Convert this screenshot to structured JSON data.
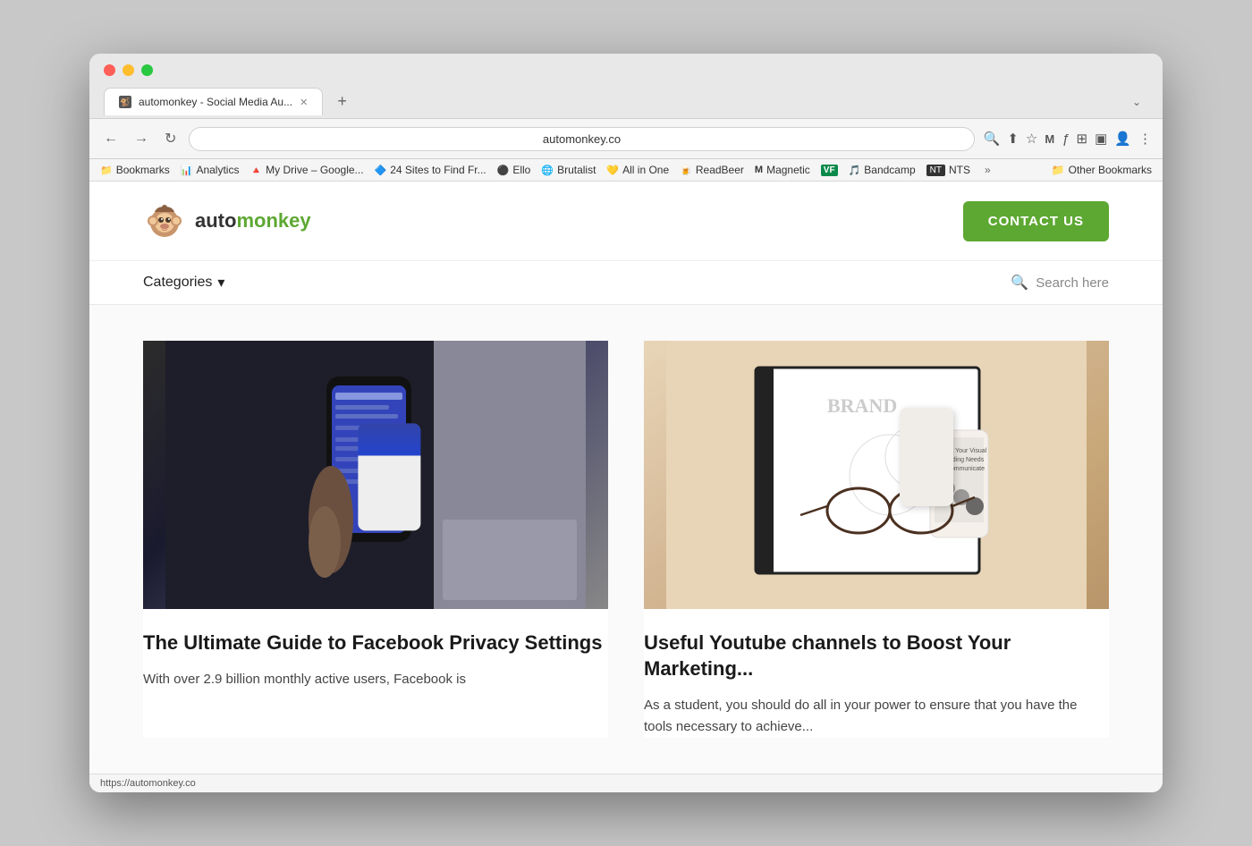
{
  "browser": {
    "tab_title": "automonkey - Social Media Au...",
    "tab_favicon": "🐒",
    "new_tab_icon": "+",
    "address": "automonkey.co",
    "expand_icon": "⌄",
    "nav": {
      "back": "←",
      "forward": "→",
      "reload": "↻"
    },
    "toolbar": {
      "search_icon": "🔍",
      "share_icon": "⬆",
      "bookmark_icon": "☆",
      "mail_icon": "M",
      "script_icon": "ƒ",
      "puzzle_icon": "⊞",
      "sidebar_icon": "▣",
      "avatar_icon": "👤",
      "more_icon": "⋮"
    },
    "bookmarks": [
      {
        "icon": "📁",
        "label": "Bookmarks"
      },
      {
        "icon": "📊",
        "label": "Analytics"
      },
      {
        "icon": "🔺",
        "label": "My Drive – Google..."
      },
      {
        "icon": "🔷",
        "label": "24 Sites to Find Fr..."
      },
      {
        "icon": "⚫",
        "label": "Ello"
      },
      {
        "icon": "🌐",
        "label": "Brutalist"
      },
      {
        "icon": "💛",
        "label": "All in One"
      },
      {
        "icon": "🍺",
        "label": "ReadBeer"
      },
      {
        "icon": "M",
        "label": "Magnetic"
      },
      {
        "icon": "VF",
        "label": "VF"
      },
      {
        "icon": "🎵",
        "label": "Bandcamp"
      },
      {
        "icon": "NT",
        "label": "NTS"
      }
    ],
    "other_bookmarks_label": "Other Bookmarks",
    "status_url": "https://automonkey.co"
  },
  "site": {
    "logo_text_plain": "auto",
    "logo_text_colored": "monkey",
    "contact_btn": "CONTACT US",
    "nav": {
      "categories_label": "Categories",
      "search_placeholder": "Search here"
    }
  },
  "posts": [
    {
      "id": "post-1",
      "image_type": "phone",
      "title": "The Ultimate Guide to Facebook Privacy Settings",
      "excerpt": "With over 2.9 billion monthly active users, Facebook is"
    },
    {
      "id": "post-2",
      "image_type": "brand",
      "title": "Useful Youtube channels to Boost Your Marketing...",
      "excerpt": "As a student, you should do all in your power to ensure that you have the tools necessary to achieve..."
    }
  ]
}
